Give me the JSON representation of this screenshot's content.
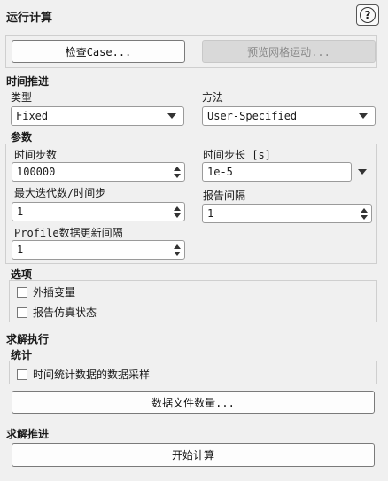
{
  "panel": {
    "title": "运行计算"
  },
  "help": {
    "icon": "help-icon",
    "glyph": "?"
  },
  "top_buttons": {
    "check_case": "检查Case...",
    "preview_mesh": "预览网格运动..."
  },
  "time_advance": {
    "section": "时间推进",
    "type_label": "类型",
    "type_value": "Fixed",
    "method_label": "方法",
    "method_value": "User-Specified"
  },
  "params": {
    "section": "参数",
    "num_steps_label": "时间步数",
    "num_steps_value": "100000",
    "step_size_label": "时间步长 [s]",
    "step_size_value": "1e-5",
    "max_iter_label": "最大迭代数/时间步",
    "max_iter_value": "1",
    "report_interval_label": "报告间隔",
    "report_interval_value": "1",
    "profile_label": "Profile数据更新间隔",
    "profile_value": "1"
  },
  "options": {
    "section": "选项",
    "extrapolate": "外插变量",
    "report_sim_status": "报告仿真状态"
  },
  "solution_exec": {
    "section": "求解执行",
    "stats_section": "统计",
    "sampling": "时间统计数据的数据采样",
    "data_file_qty": "数据文件数量..."
  },
  "solution_advance": {
    "section": "求解推进",
    "start": "开始计算"
  }
}
